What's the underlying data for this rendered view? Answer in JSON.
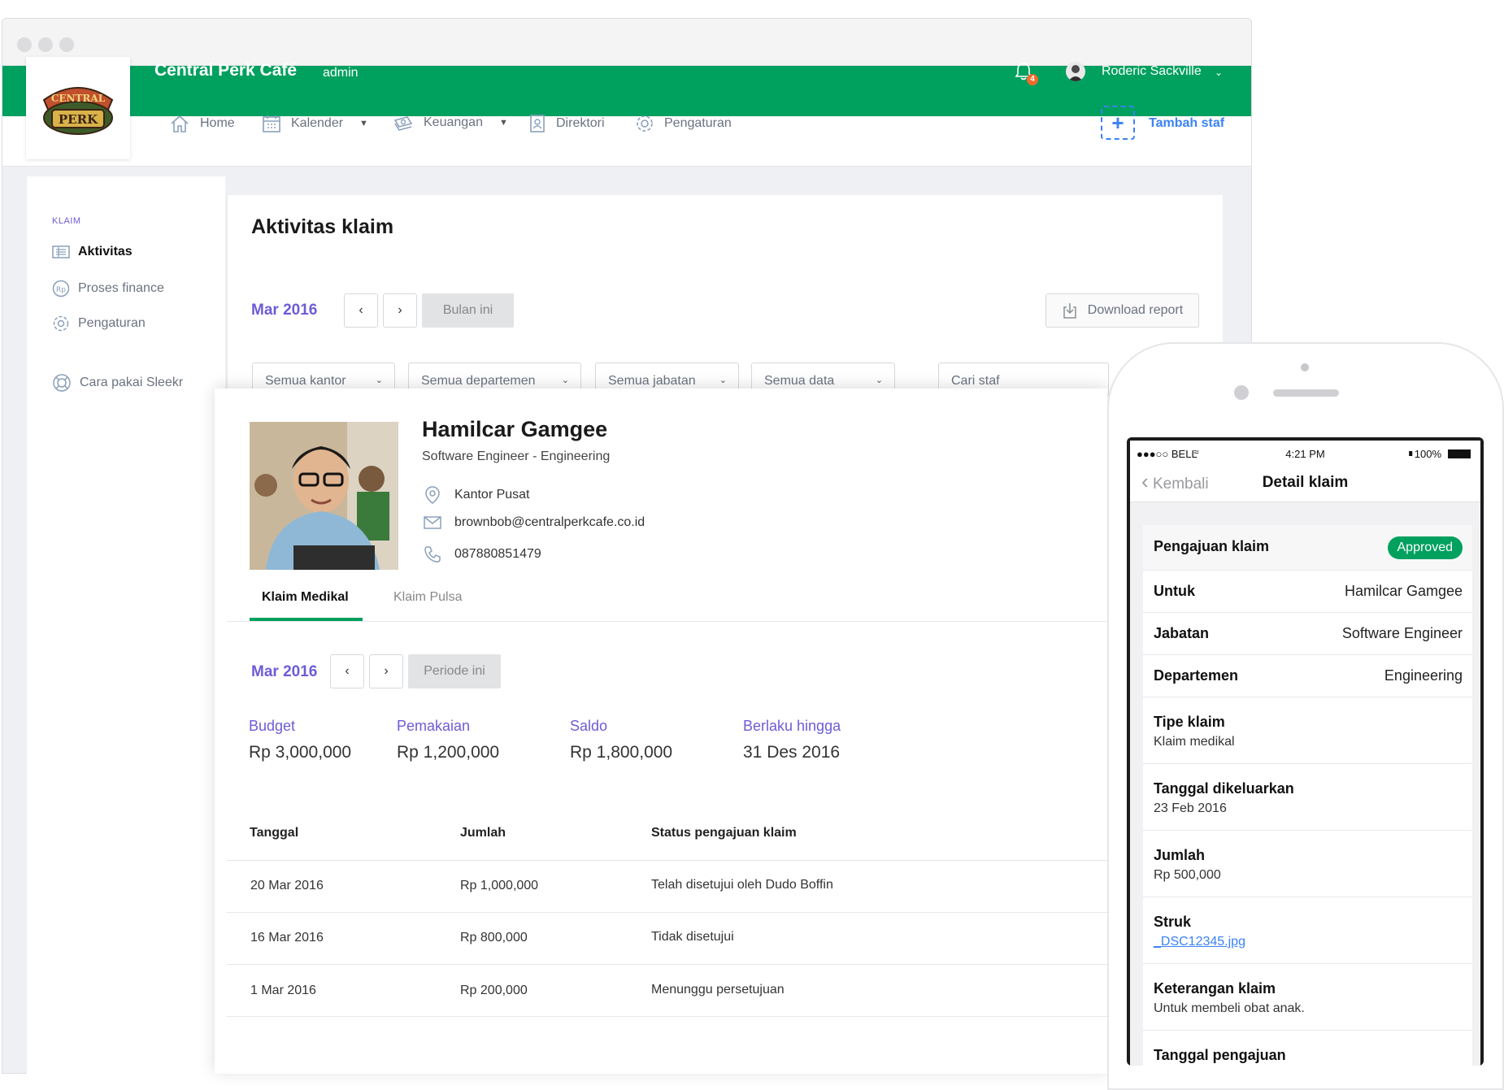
{
  "app": {
    "title": "Central Perk Café",
    "role": "admin",
    "logo_text_top": "CENTRAL",
    "logo_text_bottom": "PERK"
  },
  "colors": {
    "brand_green": "#00a05e",
    "accent_purple": "#6d5cd6",
    "link_blue": "#3b82f6",
    "badge_orange": "#f06a2b"
  },
  "header": {
    "notification_count": "4",
    "user_name": "Roderic Sackville"
  },
  "nav": {
    "items": [
      {
        "label": "Home",
        "icon": "home-icon"
      },
      {
        "label": "Kalender",
        "icon": "calendar-icon"
      },
      {
        "label": "Keuangan",
        "icon": "money-icon"
      },
      {
        "label": "Direktori",
        "icon": "directory-icon"
      },
      {
        "label": "Pengaturan",
        "icon": "gear-icon"
      }
    ],
    "add_staff_label": "Tambah staf"
  },
  "sidebar": {
    "section": "KLAIM",
    "items": [
      {
        "label": "Aktivitas",
        "icon": "list-icon",
        "active": true
      },
      {
        "label": "Proses finance",
        "icon": "finance-icon"
      },
      {
        "label": "Pengaturan",
        "icon": "gear-icon"
      },
      {
        "label": "Cara pakai Sleekr",
        "icon": "help-icon"
      }
    ]
  },
  "main": {
    "title": "Aktivitas klaim",
    "month": "Mar 2016",
    "current_month_btn": "Bulan ini",
    "download_label": "Download report",
    "filters": [
      "Semua kantor",
      "Semua departemen",
      "Semua jabatan",
      "Semua data"
    ],
    "search_placeholder": "Cari staf"
  },
  "profile": {
    "name": "Hamilcar Gamgee",
    "role": "Software Engineer - Engineering",
    "office": "Kantor Pusat",
    "email": "brownbob@centralperkcafe.co.id",
    "phone": "087880851479",
    "tabs": [
      "Klaim Medikal",
      "Klaim Pulsa"
    ],
    "period": "Mar 2016",
    "period_btn": "Periode ini",
    "stats": [
      {
        "label": "Budget",
        "value": "Rp 3,000,000"
      },
      {
        "label": "Pemakaian",
        "value": "Rp 1,200,000"
      },
      {
        "label": "Saldo",
        "value": "Rp 1,800,000"
      },
      {
        "label": "Berlaku hingga",
        "value": "31 Des 2016"
      }
    ],
    "table": {
      "headers": [
        "Tanggal",
        "Jumlah",
        "Status pengajuan klaim"
      ],
      "rows": [
        [
          "20 Mar 2016",
          "Rp 1,000,000",
          "Telah disetujui oleh Dudo Boffin"
        ],
        [
          "16 Mar 2016",
          "Rp 800,000",
          "Tidak disetujui"
        ],
        [
          "1 Mar 2016",
          "Rp 200,000",
          "Menunggu persetujuan"
        ]
      ]
    }
  },
  "phone": {
    "carrier": "●●●○○ BELL",
    "time": "4:21 PM",
    "battery": "100%",
    "back_label": "Kembali",
    "title": "Detail klaim",
    "header_label": "Pengajuan klaim",
    "status": "Approved",
    "rows_inline": [
      {
        "label": "Untuk",
        "value": "Hamilcar Gamgee"
      },
      {
        "label": "Jabatan",
        "value": "Software Engineer"
      },
      {
        "label": "Departemen",
        "value": "Engineering"
      }
    ],
    "rows_stacked": [
      {
        "label": "Tipe klaim",
        "value": "Klaim medikal"
      },
      {
        "label": "Tanggal dikeluarkan",
        "value": "23 Feb 2016"
      },
      {
        "label": "Jumlah",
        "value": "Rp 500,000"
      },
      {
        "label": "Struk",
        "value": "_DSC12345.jpg"
      },
      {
        "label": "Keterangan klaim",
        "value": "Untuk membeli obat anak."
      },
      {
        "label": "Tanggal pengajuan",
        "value": ""
      }
    ]
  }
}
